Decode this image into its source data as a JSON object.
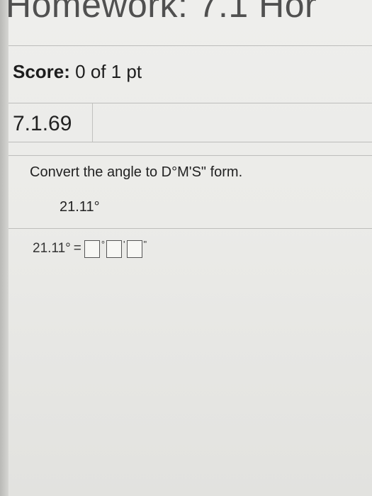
{
  "header": {
    "title": "Homework: 7.1 Hor"
  },
  "score": {
    "label": "Score:",
    "value": "0 of 1 pt"
  },
  "question": {
    "number": "7.1.69",
    "instruction": "Convert the angle to D°M'S\" form.",
    "given_angle": "21.11°",
    "answer_lhs": "21.11°",
    "equals": "=",
    "degree_symbol": "°",
    "minute_symbol": "'",
    "second_symbol": "\""
  }
}
